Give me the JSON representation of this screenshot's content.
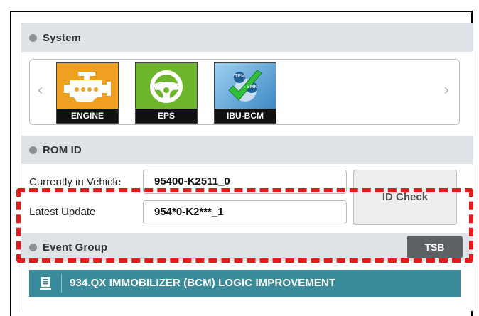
{
  "sections": {
    "system": "System",
    "rom_id": "ROM ID",
    "event_group": "Event Group"
  },
  "carousel": {
    "prev_icon": "chevron-left-icon",
    "next_icon": "chevron-right-icon",
    "prev_glyph": "‹",
    "next_glyph": "›",
    "systems": [
      {
        "label": "ENGINE",
        "icon": "engine-icon",
        "color": "#f0a020"
      },
      {
        "label": "EPS",
        "icon": "steering-wheel-icon",
        "color": "#6db52a"
      },
      {
        "label": "IBU-BCM",
        "icon": "tpms-smk-check-icon",
        "color": "#2f7fbf",
        "badge_tpm": "TPM",
        "badge_smk": "SMK"
      }
    ]
  },
  "rom": {
    "current_label": "Currently in Vehicle",
    "current_value": "95400-K2511_0",
    "latest_label": "Latest Update",
    "latest_value": "954*0-K2***_1",
    "id_check": "ID Check"
  },
  "event": {
    "tsb": "TSB",
    "item_icon": "document-icon",
    "item_text": "934.QX IMMOBILIZER (BCM) LOGIC IMPROVEMENT"
  },
  "colors": {
    "highlight": "#e31b1b",
    "event_bar": "#3a8b9b",
    "header_bg": "#dfe3e7"
  }
}
